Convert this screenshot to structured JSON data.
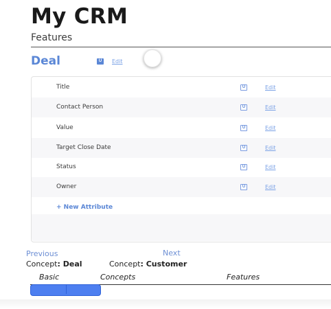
{
  "app": {
    "title": "My CRM",
    "subtitle": "Features"
  },
  "entity": {
    "name": "Deal",
    "badge": "U",
    "edit_label": "Edit"
  },
  "attributes": [
    {
      "label": "Title",
      "badge": "U",
      "edit_label": "Edit"
    },
    {
      "label": "Contact Person",
      "badge": "U",
      "edit_label": "Edit"
    },
    {
      "label": "Value",
      "badge": "U",
      "edit_label": "Edit"
    },
    {
      "label": "Target Close Date",
      "badge": "U",
      "edit_label": "Edit"
    },
    {
      "label": "Status",
      "badge": "U",
      "edit_label": "Edit"
    },
    {
      "label": "Owner",
      "badge": "U",
      "edit_label": "Edit"
    }
  ],
  "new_attribute_label": "+ New Attribute",
  "navigation": {
    "previous": {
      "label": "Previous",
      "concept_prefix": "Concept",
      "concept_name": "Deal"
    },
    "next": {
      "label": "Next",
      "concept_prefix": "Concept",
      "concept_name": "Customer"
    }
  },
  "progress": {
    "stages": [
      "Basic",
      "Concepts",
      "Features"
    ],
    "fraction": 0.23
  },
  "colors": {
    "accent": "#5b87d6",
    "progress": "#4d7ff0"
  }
}
